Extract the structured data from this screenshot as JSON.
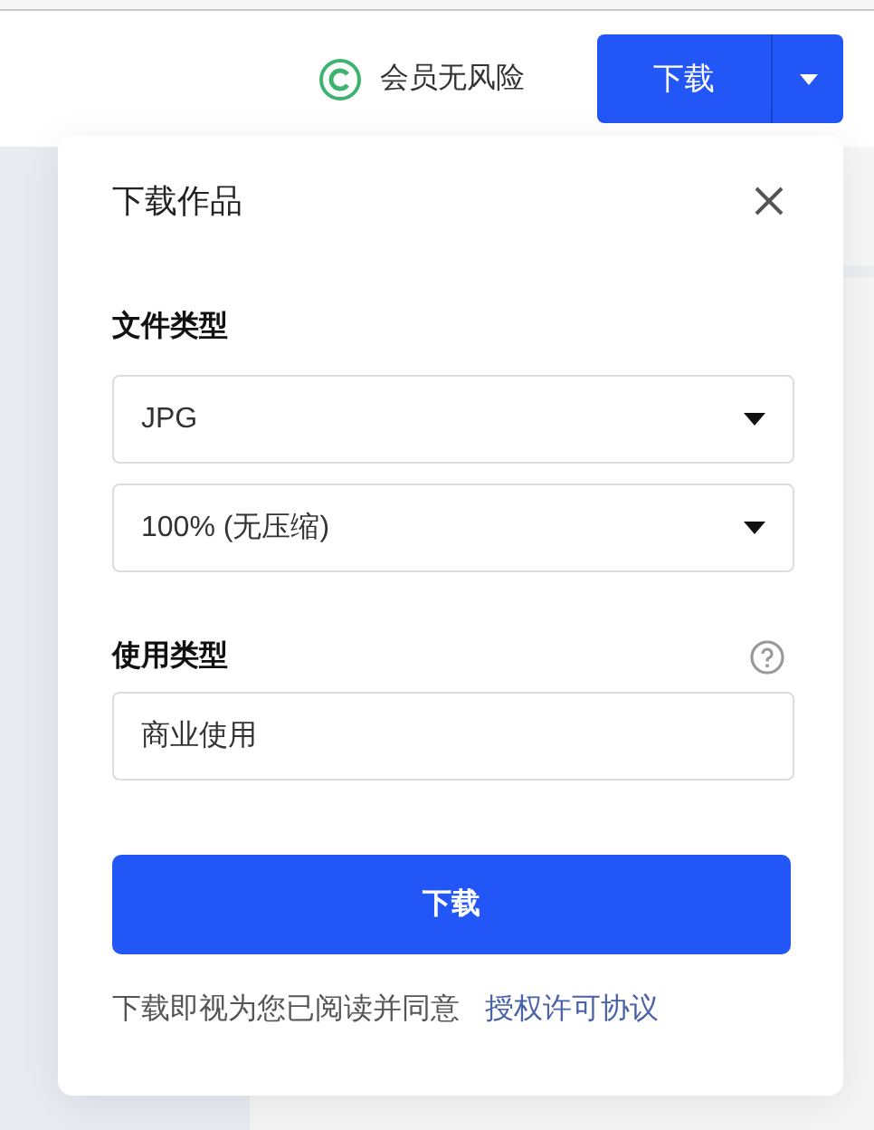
{
  "header": {
    "guarantee": "会员无风险",
    "download_button": "下载"
  },
  "dialog": {
    "title": "下载作品",
    "file_type": {
      "label": "文件类型",
      "selects": [
        {
          "value": "JPG"
        },
        {
          "value": "100% (无压缩)"
        }
      ]
    },
    "usage_type": {
      "label": "使用类型",
      "value": "商业使用"
    },
    "submit": "下载",
    "agreement": {
      "text": "下载即视为您已阅读并同意",
      "link": "授权许可协议"
    }
  }
}
